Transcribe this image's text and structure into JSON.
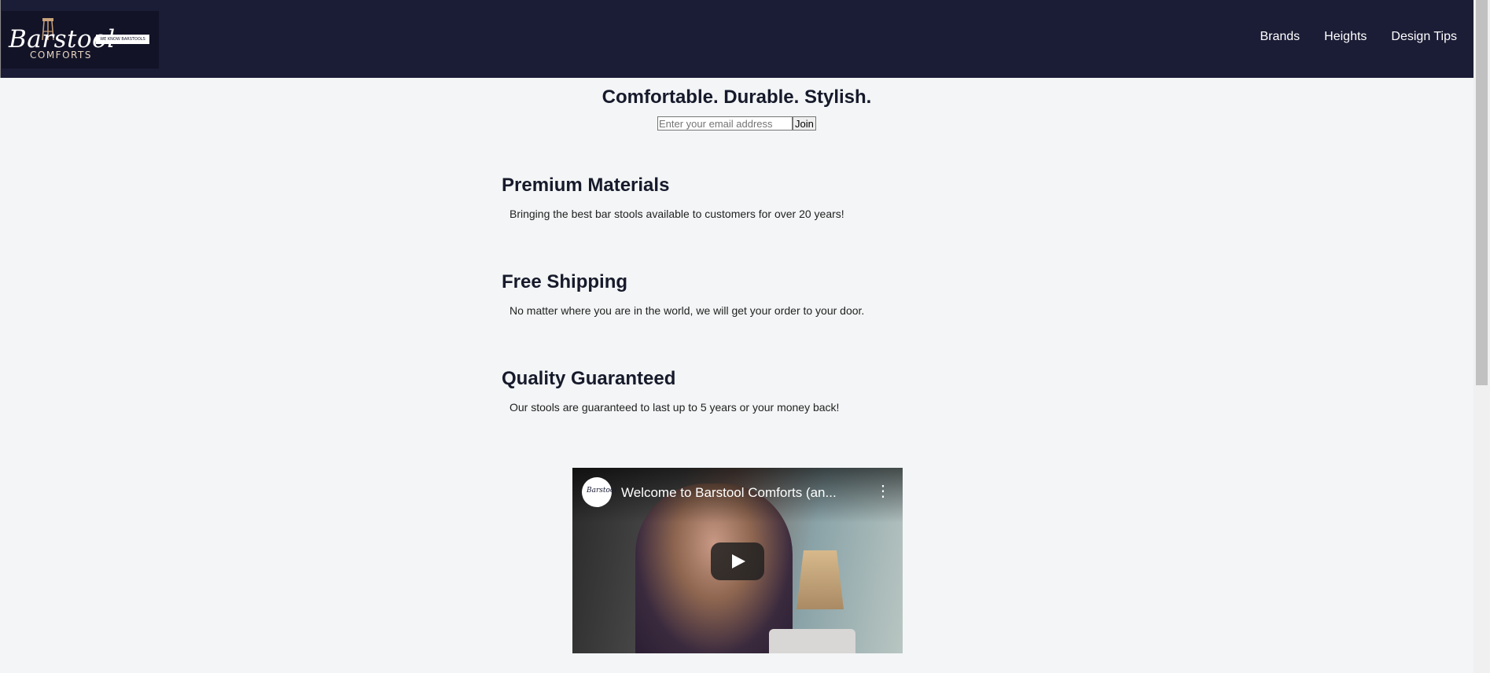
{
  "header": {
    "logo": {
      "script_text": "Barstool",
      "sub_text": "COMFORTS",
      "tag_text": "WE KNOW BARSTOOLS"
    },
    "nav": [
      {
        "label": "Brands"
      },
      {
        "label": "Heights"
      },
      {
        "label": "Design Tips"
      }
    ]
  },
  "hero": {
    "tagline": "Comfortable. Durable. Stylish.",
    "email_placeholder": "Enter your email address",
    "join_label": "Join"
  },
  "features": [
    {
      "title": "Premium Materials",
      "text": "Bringing the best bar stools available to customers for over 20 years!"
    },
    {
      "title": "Free Shipping",
      "text": "No matter where you are in the world, we will get your order to your door."
    },
    {
      "title": "Quality Guaranteed",
      "text": "Our stools are guaranteed to last up to 5 years or your money back!"
    }
  ],
  "video": {
    "title": "Welcome to Barstool Comforts (an...",
    "channel_avatar_text": "Barstool",
    "icons": {
      "menu": "more-vert-icon",
      "play": "play-icon"
    }
  },
  "colors": {
    "header_bg": "#1b1c35",
    "page_bg": "#f3f5f6",
    "heading": "#161a2b"
  }
}
